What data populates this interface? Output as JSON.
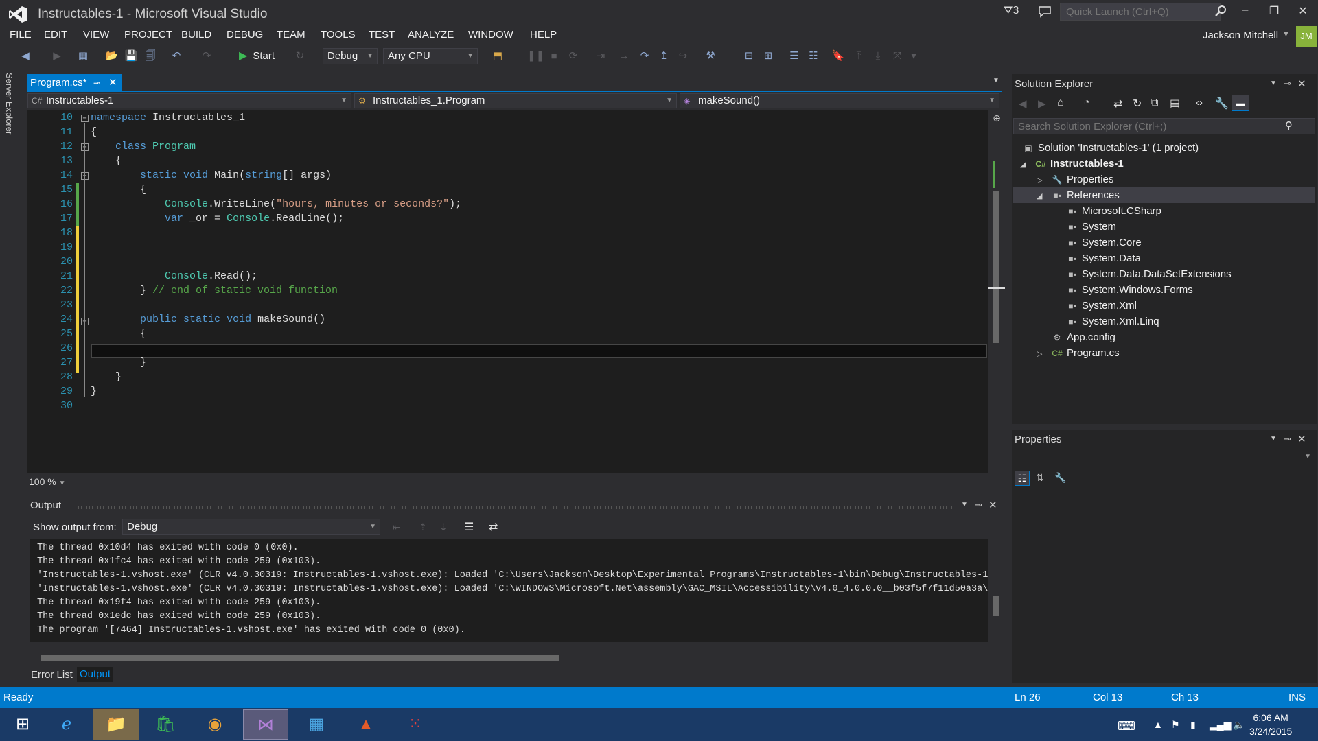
{
  "window": {
    "title": "Instructables-1 - Microsoft Visual Studio",
    "notification_count": "3",
    "quick_launch_placeholder": "Quick Launch (Ctrl+Q)",
    "minimize": "–",
    "restore": "❐",
    "close": "✕"
  },
  "menu": [
    "FILE",
    "EDIT",
    "VIEW",
    "PROJECT",
    "BUILD",
    "DEBUG",
    "TEAM",
    "TOOLS",
    "TEST",
    "ANALYZE",
    "WINDOW",
    "HELP"
  ],
  "user": {
    "name": "Jackson Mitchell",
    "initials": "JM",
    "avatar_color": "#88b23b"
  },
  "toolbar": {
    "start_label": "Start",
    "configuration": "Debug",
    "platform": "Any CPU"
  },
  "left_strip": {
    "server_explorer": "Server Explorer"
  },
  "editor": {
    "tab_label": "Program.cs*",
    "nav_project": "Instructables-1",
    "nav_class": "Instructables_1.Program",
    "nav_member": "makeSound()",
    "zoom": "100 %",
    "line_numbers": [
      "10",
      "11",
      "12",
      "13",
      "14",
      "15",
      "16",
      "17",
      "18",
      "19",
      "20",
      "21",
      "22",
      "23",
      "24",
      "25",
      "26",
      "27",
      "28",
      "29",
      "30"
    ]
  },
  "output": {
    "title": "Output",
    "show_output_from_label": "Show output from:",
    "show_output_from_value": "Debug",
    "lines": [
      "The thread 0x10d4 has exited with code 0 (0x0).",
      "The thread 0x1fc4 has exited with code 259 (0x103).",
      "'Instructables-1.vshost.exe' (CLR v4.0.30319: Instructables-1.vshost.exe): Loaded 'C:\\Users\\Jackson\\Desktop\\Experimental Programs\\Instructables-1\\bin\\Debug\\Instructables-1.e",
      "'Instructables-1.vshost.exe' (CLR v4.0.30319: Instructables-1.vshost.exe): Loaded 'C:\\WINDOWS\\Microsoft.Net\\assembly\\GAC_MSIL\\Accessibility\\v4.0_4.0.0.0__b03f5f7f11d50a3a\\Ac",
      "The thread 0x19f4 has exited with code 259 (0x103).",
      "The thread 0x1edc has exited with code 259 (0x103).",
      "The program '[7464] Instructables-1.vshost.exe' has exited with code 0 (0x0)."
    ],
    "bottom_tabs": [
      "Error List",
      "Output"
    ]
  },
  "solution_explorer": {
    "title": "Solution Explorer",
    "search_placeholder": "Search Solution Explorer (Ctrl+;)",
    "solution": "Solution 'Instructables-1' (1 project)",
    "project": "Instructables-1",
    "properties": "Properties",
    "references": "References",
    "reference_items": [
      "Microsoft.CSharp",
      "System",
      "System.Core",
      "System.Data",
      "System.Data.DataSetExtensions",
      "System.Windows.Forms",
      "System.Xml",
      "System.Xml.Linq"
    ],
    "app_config": "App.config",
    "program_cs": "Program.cs"
  },
  "properties_panel": {
    "title": "Properties"
  },
  "status": {
    "ready": "Ready",
    "ln": "Ln 26",
    "col": "Col 13",
    "ch": "Ch 13",
    "ins": "INS"
  },
  "taskbar": {
    "time": "6:06 AM",
    "date": "3/24/2015"
  },
  "colors": {
    "accent": "#007acc",
    "vs_purple": "#68217a",
    "change_saved": "#57a64a",
    "change_unsaved": "#efce3b"
  }
}
